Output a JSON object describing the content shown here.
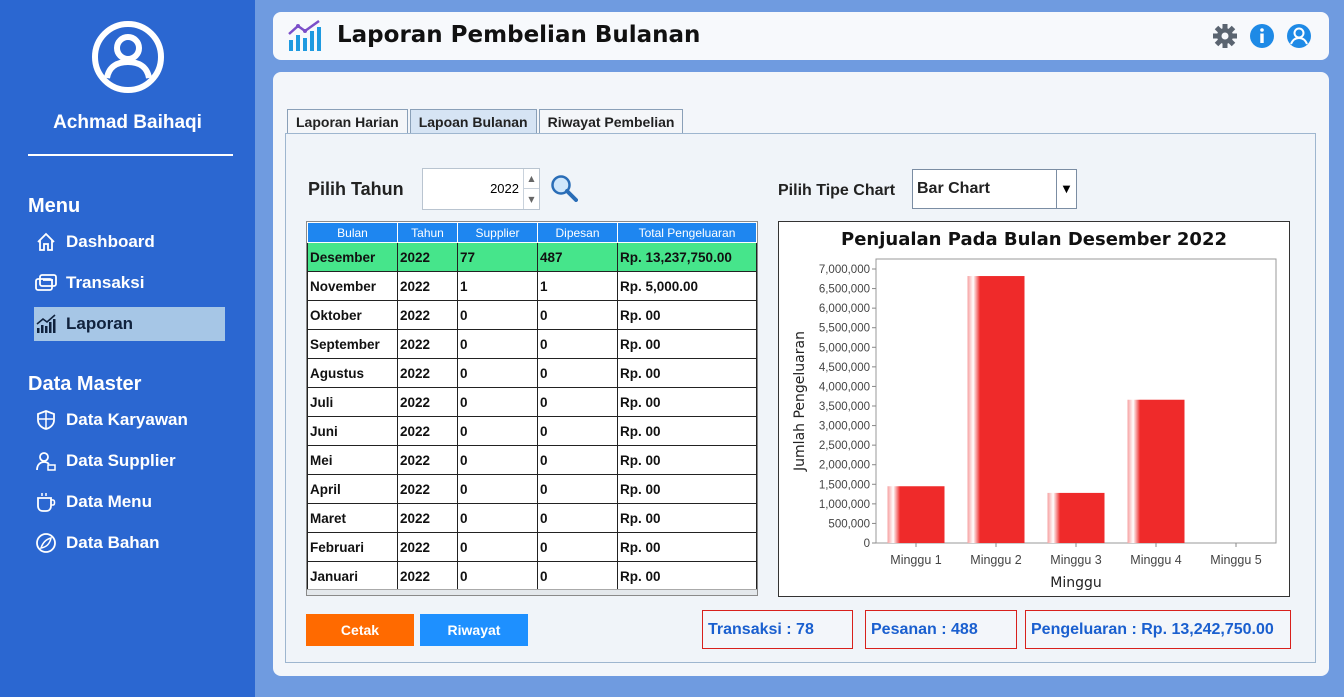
{
  "user": {
    "name": "Achmad Baihaqi"
  },
  "sidebar": {
    "menu_title": "Menu",
    "menu_items": [
      {
        "label": "Dashboard",
        "icon": "home-icon"
      },
      {
        "label": "Transaksi",
        "icon": "transaction-icon"
      },
      {
        "label": "Laporan",
        "icon": "report-chart-icon",
        "active": true
      }
    ],
    "master_title": "Data Master",
    "master_items": [
      {
        "label": "Data Karyawan",
        "icon": "shield-icon"
      },
      {
        "label": "Data Supplier",
        "icon": "supplier-user-icon"
      },
      {
        "label": "Data Menu",
        "icon": "cup-icon"
      },
      {
        "label": "Data Bahan",
        "icon": "leaf-icon"
      }
    ]
  },
  "header": {
    "title": "Laporan Pembelian Bulanan"
  },
  "tabs": [
    {
      "label": "Laporan Harian"
    },
    {
      "label": "Lapoan Bulanan",
      "active": true
    },
    {
      "label": "Riwayat Pembelian"
    }
  ],
  "filters": {
    "year_label": "Pilih Tahun",
    "year_value": "2022",
    "chart_type_label": "Pilih Tipe Chart",
    "chart_type_value": "Bar Chart"
  },
  "table": {
    "headers": [
      "Bulan",
      "Tahun",
      "Supplier",
      "Dipesan",
      "Total Pengeluaran"
    ],
    "rows": [
      [
        "Desember",
        "2022",
        "77",
        "487",
        "Rp. 13,237,750.00"
      ],
      [
        "November",
        "2022",
        "1",
        "1",
        "Rp. 5,000.00"
      ],
      [
        "Oktober",
        "2022",
        "0",
        "0",
        "Rp. 00"
      ],
      [
        "September",
        "2022",
        "0",
        "0",
        "Rp. 00"
      ],
      [
        "Agustus",
        "2022",
        "0",
        "0",
        "Rp. 00"
      ],
      [
        "Juli",
        "2022",
        "0",
        "0",
        "Rp. 00"
      ],
      [
        "Juni",
        "2022",
        "0",
        "0",
        "Rp. 00"
      ],
      [
        "Mei",
        "2022",
        "0",
        "0",
        "Rp. 00"
      ],
      [
        "April",
        "2022",
        "0",
        "0",
        "Rp. 00"
      ],
      [
        "Maret",
        "2022",
        "0",
        "0",
        "Rp. 00"
      ],
      [
        "Februari",
        "2022",
        "0",
        "0",
        "Rp. 00"
      ],
      [
        "Januari",
        "2022",
        "0",
        "0",
        "Rp. 00"
      ]
    ],
    "selected_row": 0
  },
  "chart_data": {
    "type": "bar",
    "title": "Penjualan Pada Bulan Desember 2022",
    "xlabel": "Minggu",
    "ylabel": "Jumlah Pengeluaran",
    "categories": [
      "Minggu 1",
      "Minggu 2",
      "Minggu 3",
      "Minggu 4",
      "Minggu 5"
    ],
    "values": [
      1450000,
      6820000,
      1280000,
      3660000,
      0
    ],
    "ylim": [
      0,
      7000000
    ],
    "yticks": [
      0,
      500000,
      1000000,
      1500000,
      2000000,
      2500000,
      3000000,
      3500000,
      4000000,
      4500000,
      5000000,
      5500000,
      6000000,
      6500000,
      7000000
    ],
    "ytick_labels": [
      "0",
      "500,000",
      "1,000,000",
      "1,500,000",
      "2,000,000",
      "2,500,000",
      "3,000,000",
      "3,500,000",
      "4,000,000",
      "4,500,000",
      "5,000,000",
      "5,500,000",
      "6,000,000",
      "6,500,000",
      "7,000,000"
    ],
    "color": "#ef2a2a",
    "grid": false
  },
  "actions": {
    "print_label": "Cetak",
    "history_label": "Riwayat",
    "print_color": "#ff6a00",
    "history_color": "#1e90ff"
  },
  "summary": {
    "transaksi": "Transaksi : 78",
    "pesanan": "Pesanan : 488",
    "pengeluaran": "Pengeluaran : Rp. 13,242,750.00"
  }
}
